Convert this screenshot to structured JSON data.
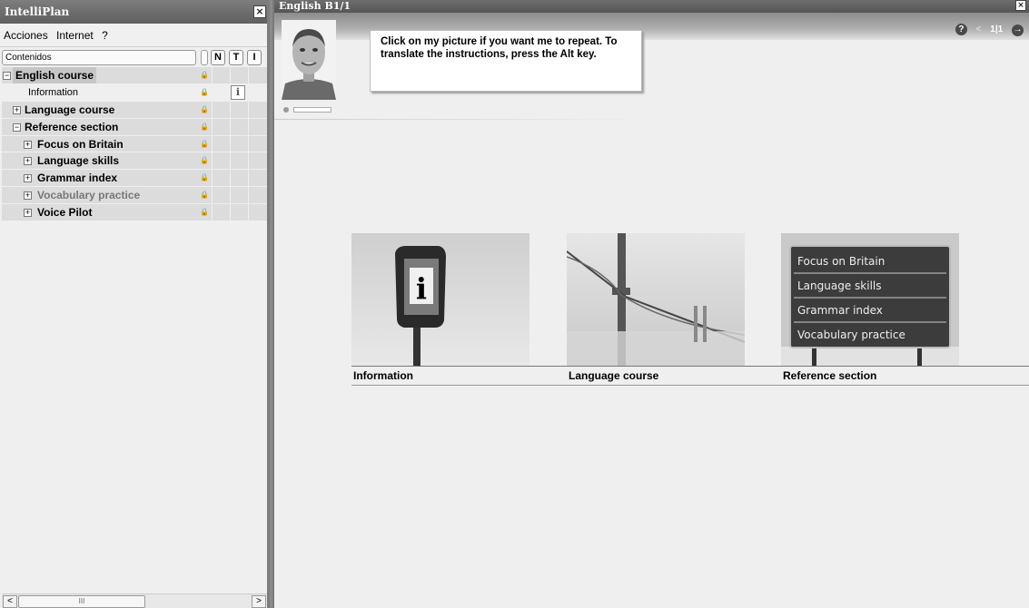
{
  "left_window": {
    "title": "IntelliPlan",
    "close_glyph": "×",
    "menu": [
      "Acciones",
      "Internet",
      "?"
    ],
    "contents_header": "Contenidos",
    "columns": [
      "N",
      "T",
      "I"
    ],
    "tree": [
      {
        "label": "English course",
        "expander": "−",
        "level": 0
      },
      {
        "label": "Information",
        "expander": "",
        "level": 1
      },
      {
        "label": "Language course",
        "expander": "+",
        "level": 1
      },
      {
        "label": "Reference section",
        "expander": "−",
        "level": 1
      },
      {
        "label": "Focus on Britain",
        "expander": "+",
        "level": 2
      },
      {
        "label": "Language skills",
        "expander": "+",
        "level": 2
      },
      {
        "label": "Grammar index",
        "expander": "+",
        "level": 2
      },
      {
        "label": "Vocabulary practice",
        "expander": "+",
        "level": 2
      },
      {
        "label": "Voice Pilot",
        "expander": "+",
        "level": 2
      }
    ],
    "info_icon_glyph": "i",
    "scroll_left": "<",
    "scroll_right": ">",
    "scroll_thumb": "III"
  },
  "right_window": {
    "title": "English B1/1",
    "close_glyph": "×",
    "help_glyph": "?",
    "back_glyph": "<",
    "page_indicator": "1|1",
    "forward_glyph": "→",
    "speech_bubble": "Click on my picture if you want me to repeat. To translate the instructions, press the Alt key.",
    "tiles": [
      {
        "caption": "Information",
        "icon_letter": "i"
      },
      {
        "caption": "Language course"
      },
      {
        "caption": "Reference section",
        "sign_items": [
          "Focus on Britain",
          "Language skills",
          "Grammar index",
          "Vocabulary practice"
        ]
      }
    ]
  },
  "colors": {
    "title_bar": "#6a6a6a",
    "tree_row": "#dcdcdc",
    "panel_bg": "#efefef",
    "sign_bg": "#3c3c3c"
  }
}
